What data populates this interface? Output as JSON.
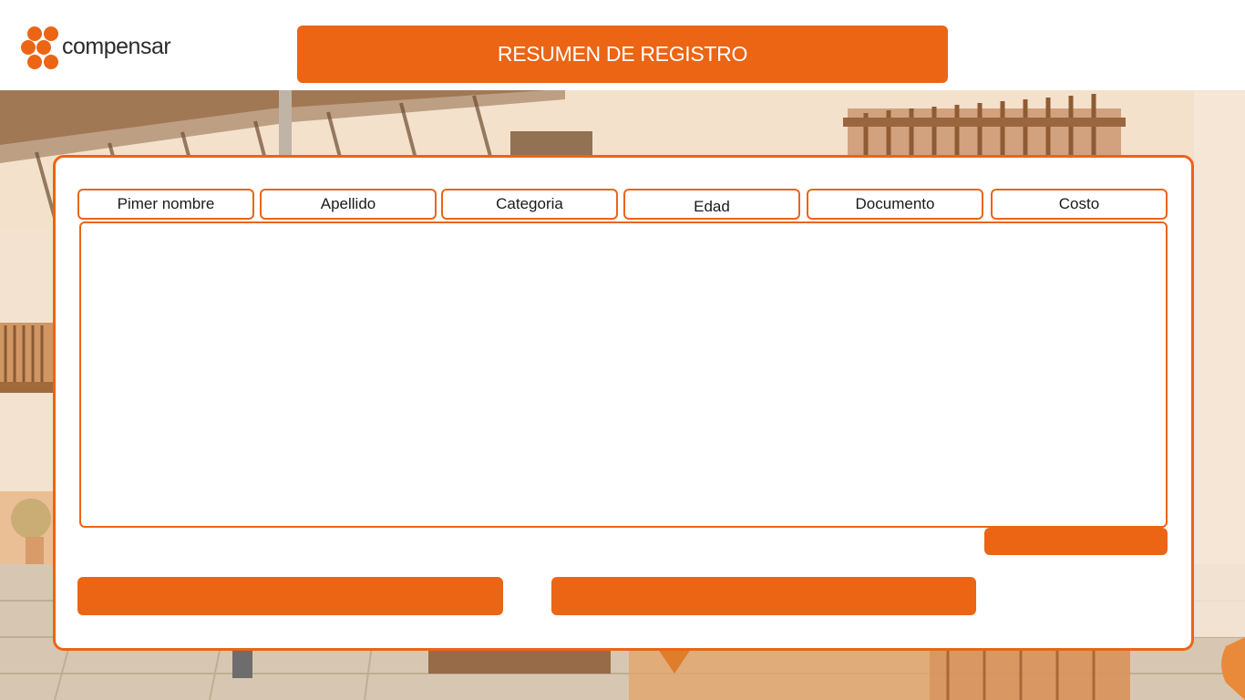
{
  "header": {
    "logo_text": "compensar",
    "title": "RESUMEN DE REGISTRO"
  },
  "table": {
    "columns": [
      {
        "label": "Pimer nombre"
      },
      {
        "label": "Apellido"
      },
      {
        "label": "Categoria"
      },
      {
        "label": "Edad"
      },
      {
        "label": "Documento"
      },
      {
        "label": "Costo"
      }
    ],
    "rows": []
  },
  "colors": {
    "brand_orange": "#eb6515",
    "panel_background": "#ffffff",
    "logo_text": "#2b2b2b"
  },
  "icons": {
    "logo": "compensar-logo-icon"
  },
  "background": {
    "scene": "colonial-house-courtyard-photo"
  }
}
